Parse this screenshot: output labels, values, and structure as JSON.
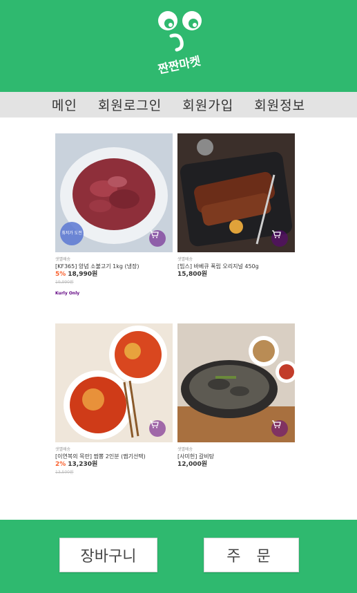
{
  "header": {
    "logo_text": "짠짠마켓",
    "logo_icon": "smiley-face-logo"
  },
  "nav": {
    "items": [
      "메인",
      "회원로그인",
      "회원가입",
      "회원정보"
    ]
  },
  "products": [
    {
      "image": "marinated-beef-plate",
      "badge": "최저가 도전",
      "delivery": "샛별배송",
      "name": "[KF365] 양념 소불고기 1kg (냉장)",
      "discount": "5%",
      "price": "18,990원",
      "original_price": "19,990원",
      "tag": "Kurly Only"
    },
    {
      "image": "bbq-pork-ribs-tray",
      "delivery": "샛별배송",
      "name": "[빕스] 바베큐 폭립 오리지널 450g",
      "price": "15,800원"
    },
    {
      "image": "spicy-noodles-bowls",
      "delivery": "샛별배송",
      "name": "[이연복의 목란] 짬뽕 2인분 (맵기선택)",
      "discount": "2%",
      "price": "13,230원",
      "original_price": "13,500원"
    },
    {
      "image": "galbitang-soup-bowl",
      "delivery": "샛별배송",
      "name": "[사미헌] 갈비탕",
      "price": "12,000원"
    }
  ],
  "footer": {
    "cart_label": "장바구니",
    "order_label": "주 문"
  },
  "colors": {
    "brand_green": "#2fb96f",
    "nav_bg": "#e3e3e3",
    "discount": "#fa622f",
    "kurly_purple": "#5f0080"
  }
}
